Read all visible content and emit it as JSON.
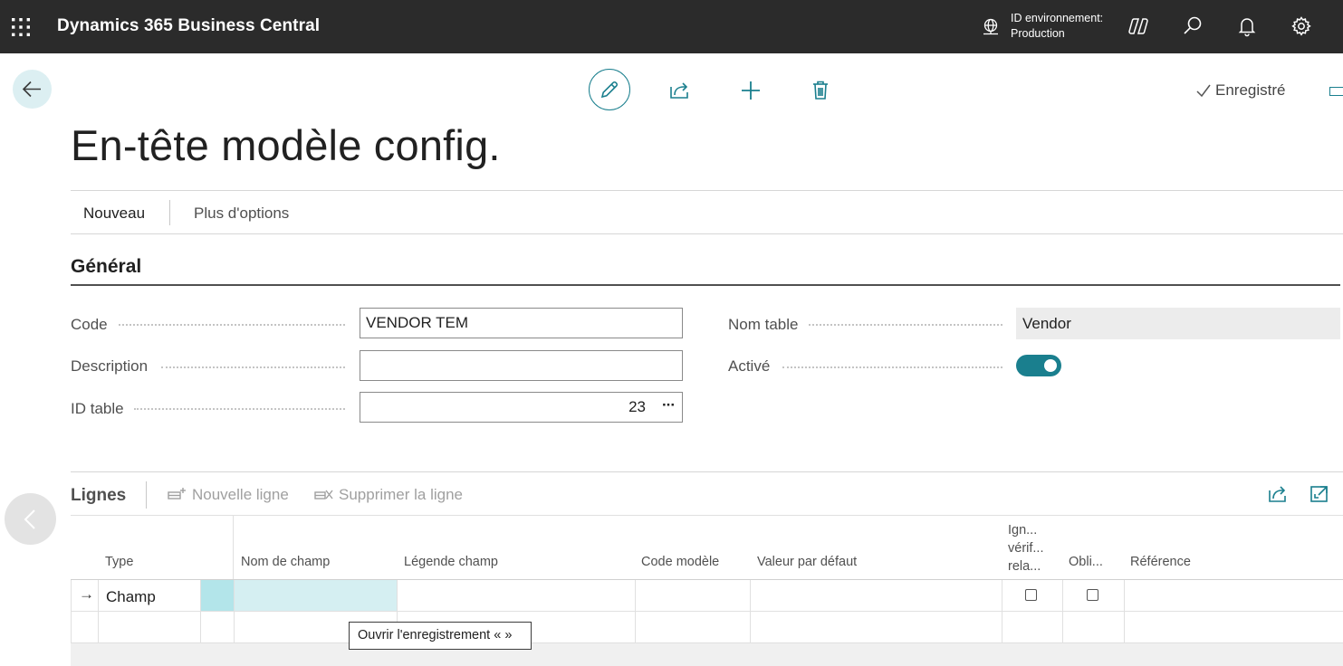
{
  "topbar": {
    "app_title": "Dynamics 365 Business Central",
    "environment_label": "ID environnement:",
    "environment_value": "Production"
  },
  "actions": {
    "saved_label": "Enregistré"
  },
  "page": {
    "title": "En-tête modèle config."
  },
  "menu": {
    "items": [
      "Nouveau",
      "Plus d'options"
    ]
  },
  "general": {
    "title": "Général",
    "code_label": "Code",
    "code_value": "VENDOR TEM",
    "description_label": "Description",
    "description_value": "",
    "table_id_label": "ID table",
    "table_id_value": "23",
    "table_name_label": "Nom table",
    "table_name_value": "Vendor",
    "active_label": "Activé",
    "active_value": true,
    "more_glyph": "···"
  },
  "lines": {
    "title": "Lignes",
    "new_line": "Nouvelle ligne",
    "delete_line": "Supprimer la ligne",
    "columns": {
      "type": "Type",
      "field_name": "Nom de champ",
      "field_caption": "Légende champ",
      "template_code": "Code modèle",
      "default_value": "Valeur par défaut",
      "ignore_1": "Ign...",
      "ignore_2": "vérif...",
      "ignore_3": "rela...",
      "mandatory": "Obli...",
      "reference": "Référence"
    },
    "rows": [
      {
        "marker": "→",
        "type": "Champ",
        "field_name": "",
        "field_caption": "",
        "template_code": "",
        "default_value": "",
        "ignore": false,
        "mandatory": false,
        "reference": ""
      }
    ],
    "tooltip": "Ouvrir l'enregistrement «  »"
  },
  "colors": {
    "topbar": "#2b2b2b",
    "accent": "#1a7f8e",
    "selected_cell": "#b3e5ea"
  }
}
